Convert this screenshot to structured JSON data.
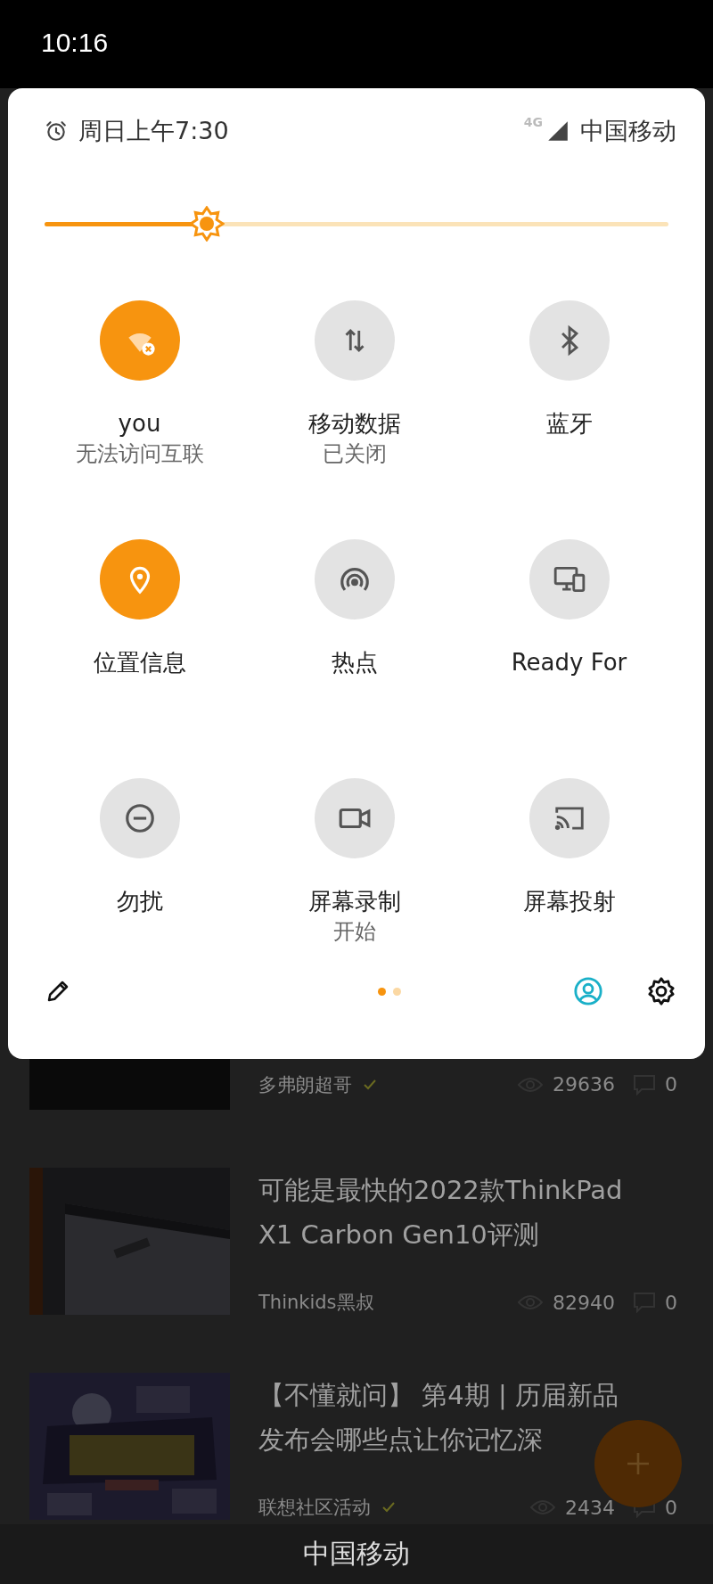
{
  "status_bar": {
    "time": "10:16"
  },
  "quick_settings": {
    "alarm": "周日上午7:30",
    "network_type": "4G",
    "carrier": "中国移动",
    "brightness": {
      "level": 0.26
    },
    "tiles": [
      {
        "label": "you",
        "sublabel": "无法访问互联",
        "active": true
      },
      {
        "label": "移动数据",
        "sublabel": "已关闭",
        "active": false
      },
      {
        "label": "蓝牙",
        "active": false
      },
      {
        "label": "位置信息",
        "active": true
      },
      {
        "label": "热点",
        "active": false
      },
      {
        "label": "Ready For",
        "active": false
      },
      {
        "label": "勿扰",
        "active": false
      },
      {
        "label": "屏幕录制",
        "sublabel": "开始",
        "active": false
      },
      {
        "label": "屏幕投射",
        "active": false
      }
    ],
    "pages": [
      {
        "selected": true
      },
      {
        "selected": false
      }
    ]
  },
  "feed": [
    {
      "kind": "partial",
      "author": "多弗朗超哥",
      "verified": true,
      "views": "29636",
      "comments": "0"
    },
    {
      "kind": "full",
      "title_lines": [
        "可能是最快的2022款ThinkPad",
        "X1 Carbon Gen10评测"
      ],
      "author": "Thinkids黑叔",
      "verified": false,
      "views": "82940",
      "comments": "0"
    },
    {
      "kind": "full",
      "title_lines": [
        "【不懂就问】 第4期 | 历届新品",
        "发布会哪些点让你记忆深"
      ],
      "author": "联想社区活动",
      "verified": true,
      "views": "2434",
      "comments": "0"
    }
  ],
  "carrier_label": "中国移动"
}
